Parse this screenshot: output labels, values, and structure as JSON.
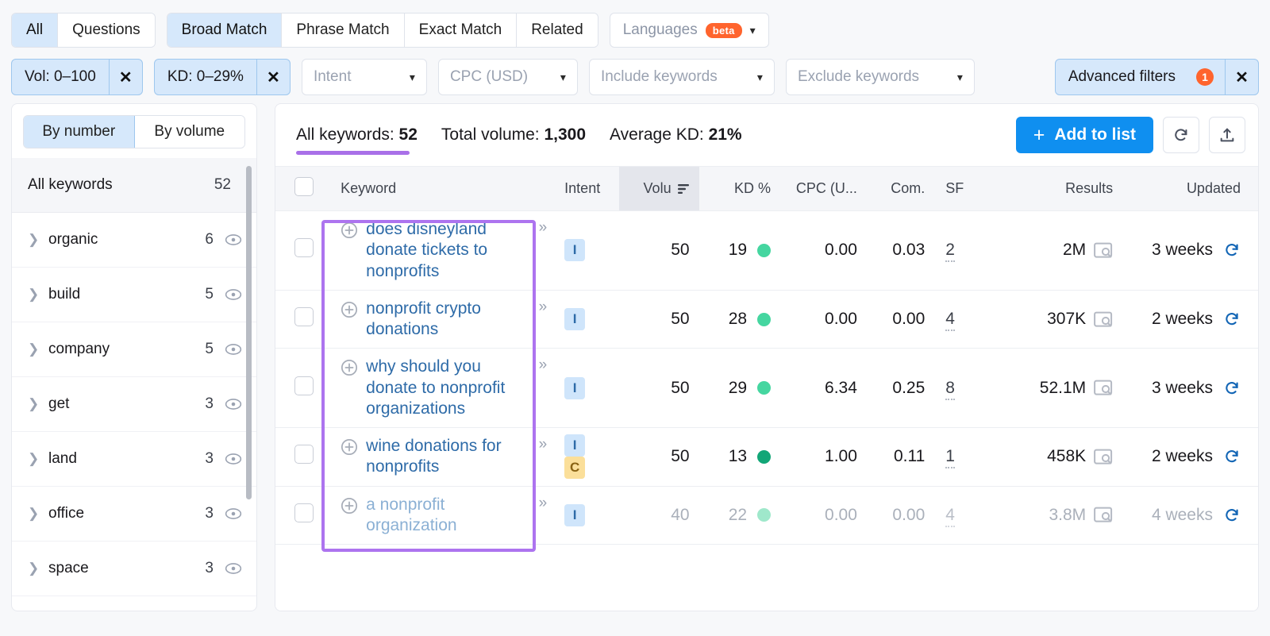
{
  "filters": {
    "match_tabs": [
      {
        "label": "All",
        "active": true
      },
      {
        "label": "Questions",
        "active": false
      }
    ],
    "match_types": [
      {
        "label": "Broad Match",
        "active": true
      },
      {
        "label": "Phrase Match",
        "active": false
      },
      {
        "label": "Exact Match",
        "active": false
      },
      {
        "label": "Related",
        "active": false
      }
    ],
    "languages": {
      "label": "Languages",
      "badge": "beta"
    },
    "active_pills": [
      {
        "label": "Vol: 0–100"
      },
      {
        "label": "KD: 0–29%"
      }
    ],
    "dropdowns": [
      {
        "label": "Intent"
      },
      {
        "label": "CPC (USD)"
      },
      {
        "label": "Include keywords"
      },
      {
        "label": "Exclude keywords"
      }
    ],
    "advanced": {
      "label": "Advanced filters",
      "count": "1"
    }
  },
  "sidebar": {
    "toggle": [
      {
        "label": "By number",
        "active": true
      },
      {
        "label": "By volume",
        "active": false
      }
    ],
    "all_keywords": {
      "label": "All keywords",
      "count": "52"
    },
    "groups": [
      {
        "label": "organic",
        "count": "6"
      },
      {
        "label": "build",
        "count": "5"
      },
      {
        "label": "company",
        "count": "5"
      },
      {
        "label": "get",
        "count": "3"
      },
      {
        "label": "land",
        "count": "3"
      },
      {
        "label": "office",
        "count": "3"
      },
      {
        "label": "space",
        "count": "3"
      }
    ]
  },
  "summary": {
    "all_keywords_label": "All keywords:",
    "all_keywords_value": "52",
    "total_volume_label": "Total volume:",
    "total_volume_value": "1,300",
    "average_kd_label": "Average KD:",
    "average_kd_value": "21%",
    "add_to_list": "Add to list",
    "plus": "+"
  },
  "table": {
    "headers": {
      "keyword": "Keyword",
      "intent": "Intent",
      "volume": "Volu",
      "kd": "KD %",
      "cpc": "CPC (U...",
      "com": "Com.",
      "sf": "SF",
      "results": "Results",
      "updated": "Updated"
    },
    "rows": [
      {
        "keyword": "does disneyland donate tickets to nonprofits",
        "intents": [
          "I"
        ],
        "volume": "50",
        "kd": "19",
        "kd_color": "#45d6a0",
        "cpc": "0.00",
        "com": "0.03",
        "sf": "2",
        "results": "2M",
        "updated": "3 weeks",
        "faded": false
      },
      {
        "keyword": "nonprofit crypto donations",
        "intents": [
          "I"
        ],
        "volume": "50",
        "kd": "28",
        "kd_color": "#45d6a0",
        "cpc": "0.00",
        "com": "0.00",
        "sf": "4",
        "results": "307K",
        "updated": "2 weeks",
        "faded": false
      },
      {
        "keyword": "why should you donate to nonprofit organizations",
        "intents": [
          "I"
        ],
        "volume": "50",
        "kd": "29",
        "kd_color": "#45d6a0",
        "cpc": "6.34",
        "com": "0.25",
        "sf": "8",
        "results": "52.1M",
        "updated": "3 weeks",
        "faded": false
      },
      {
        "keyword": "wine donations for nonprofits",
        "intents": [
          "I",
          "C"
        ],
        "volume": "50",
        "kd": "13",
        "kd_color": "#12a677",
        "cpc": "1.00",
        "com": "0.11",
        "sf": "1",
        "results": "458K",
        "updated": "2 weeks",
        "faded": false
      },
      {
        "keyword": "a nonprofit organization",
        "intents": [
          "I"
        ],
        "volume": "40",
        "kd": "22",
        "kd_color": "#9fe8cb",
        "cpc": "0.00",
        "com": "0.00",
        "sf": "4",
        "results": "3.8M",
        "updated": "4 weeks",
        "faded": true
      }
    ],
    "arrows_glyph": "»"
  },
  "colors": {
    "accent_blue": "#0f8ff0",
    "active_pill": "#d6e8fb",
    "orange_badge": "#ff642d",
    "highlight_purple": "#ad74ef",
    "underline_purple": "#a970e8"
  }
}
